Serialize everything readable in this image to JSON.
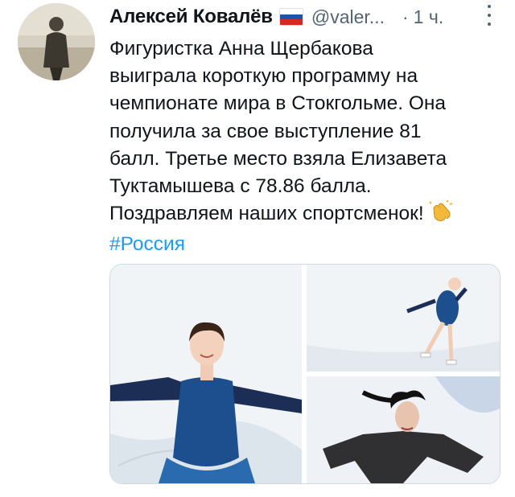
{
  "tweet": {
    "author_name": "Алексей Ковалёв",
    "flag": "russia-flag",
    "handle": "@valer...",
    "separator": "·",
    "time": "1 ч.",
    "lines": [
      "Фигуристка Анна Щербакова",
      "выиграла короткую программу на",
      "чемпионате мира в Стокгольме. Она",
      "получила за свое выступление 81",
      "балл. Третье место взяла Елизавета",
      "Туктамышева с 78.86 балла.",
      "Поздравляем наших спортсменок!"
    ],
    "emoji": "clapping-hands-icon",
    "hashtag": "#Россия"
  },
  "colors": {
    "text": "#0f1419",
    "secondary": "#536471",
    "link": "#1d9bf0",
    "border": "#cfd9de"
  }
}
